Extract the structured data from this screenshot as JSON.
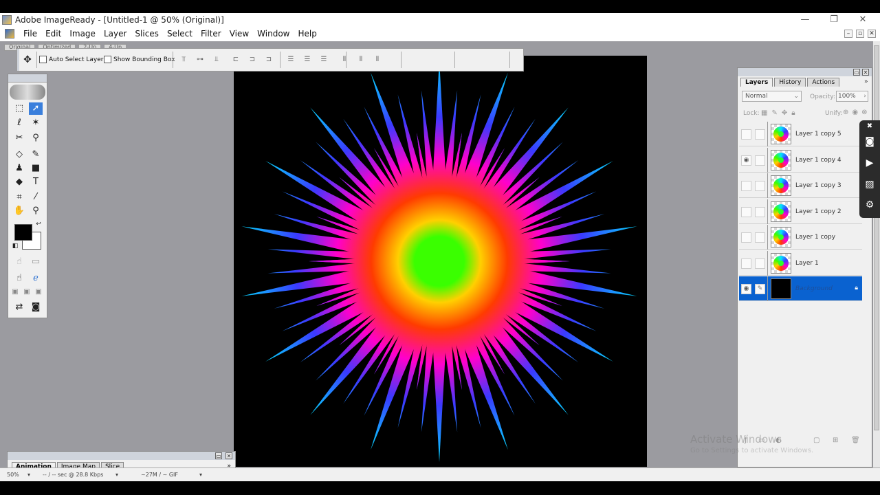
{
  "window": {
    "title": "Adobe ImageReady - [Untitled-1 @ 50% (Original)]",
    "minimize": "—",
    "maximize": "❐",
    "close": "✕"
  },
  "menu": {
    "items": [
      "File",
      "Edit",
      "Image",
      "Layer",
      "Slices",
      "Select",
      "Filter",
      "View",
      "Window",
      "Help"
    ],
    "mdi_min": "–",
    "mdi_restore": "▫",
    "mdi_close": "✕"
  },
  "doc_tabs": [
    "Original",
    "Optimized",
    "2-Up",
    "4-Up"
  ],
  "options_bar": {
    "auto_select_layer": "Auto Select Layer",
    "show_bounding_box": "Show Bounding Box",
    "align_icons": [
      "top-align",
      "vcenter-align",
      "bottom-align",
      "left-align",
      "hcenter-align",
      "right-align",
      "dist-top",
      "dist-vcenter",
      "dist-bottom",
      "dist-left",
      "dist-hcenter",
      "dist-right"
    ]
  },
  "toolbox": {
    "tools": [
      "marquee",
      "move",
      "lasso",
      "magic-wand",
      "slice",
      "slice-select",
      "eraser",
      "brush",
      "clone-stamp",
      "rectangle",
      "paint-bucket",
      "type",
      "crop",
      "eyedropper",
      "hand",
      "zoom"
    ]
  },
  "layers_panel": {
    "tabs": [
      "Layers",
      "History",
      "Actions"
    ],
    "blend_mode": "Normal",
    "opacity_label": "Opacity:",
    "opacity_value": "100%",
    "lock_label": "Lock:",
    "unify_label": "Unify:",
    "layers": [
      {
        "name": "Layer 1 copy 5",
        "visible": false
      },
      {
        "name": "Layer 1 copy 4",
        "visible": true
      },
      {
        "name": "Layer 1 copy 3",
        "visible": false
      },
      {
        "name": "Layer 1 copy 2",
        "visible": false
      },
      {
        "name": "Layer 1 copy",
        "visible": false
      },
      {
        "name": "Layer 1",
        "visible": false
      },
      {
        "name": "Background",
        "visible": true,
        "selected": true
      }
    ]
  },
  "animation_panel": {
    "tabs": [
      "Animation",
      "Image Map",
      "Slice"
    ]
  },
  "status_bar": {
    "zoom": "50%",
    "download": "-- / -- sec @ 28.8 Kbps",
    "size": "~27M / ~ GIF"
  },
  "watermark": {
    "line1": "Activate Windows",
    "line2": "Go to Settings to activate Windows."
  },
  "colors": {
    "workspace": "#9b9ba0",
    "canvas": "#000000",
    "selected_layer": "#0a62d0",
    "burst": [
      "#00e5ff",
      "#3a3aff",
      "#ff00cc",
      "#ff3b00",
      "#ffd000",
      "#3aff00"
    ]
  }
}
